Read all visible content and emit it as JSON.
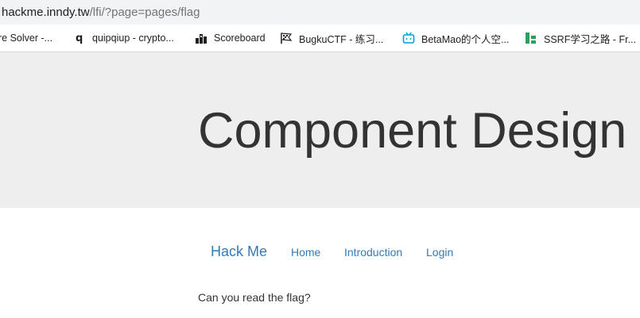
{
  "browser": {
    "url_host": "hackme.inndy.tw",
    "url_path": "/lfi/?page=pages/flag"
  },
  "bookmarks": [
    {
      "label": "re Solver -...",
      "icon": "page-icon"
    },
    {
      "label": "quipqiup - crypto...",
      "icon": "q-icon"
    },
    {
      "label": "Scoreboard",
      "icon": "bars-icon"
    },
    {
      "label": "BugkuCTF - 练习...",
      "icon": "flag-icon"
    },
    {
      "label": "BetaMao的个人空...",
      "icon": "tv-icon"
    },
    {
      "label": "SSRF学习之路 - Fr...",
      "icon": "green-blocks-icon"
    }
  ],
  "jumbotron": {
    "title": "Component Design"
  },
  "nav": {
    "brand": "Hack Me",
    "links": [
      "Home",
      "Introduction",
      "Login"
    ]
  },
  "content": {
    "text": "Can you read the flag?"
  },
  "colors": {
    "link": "#337ab7",
    "jumbotron_bg": "#eeeeee",
    "text": "#333333"
  }
}
